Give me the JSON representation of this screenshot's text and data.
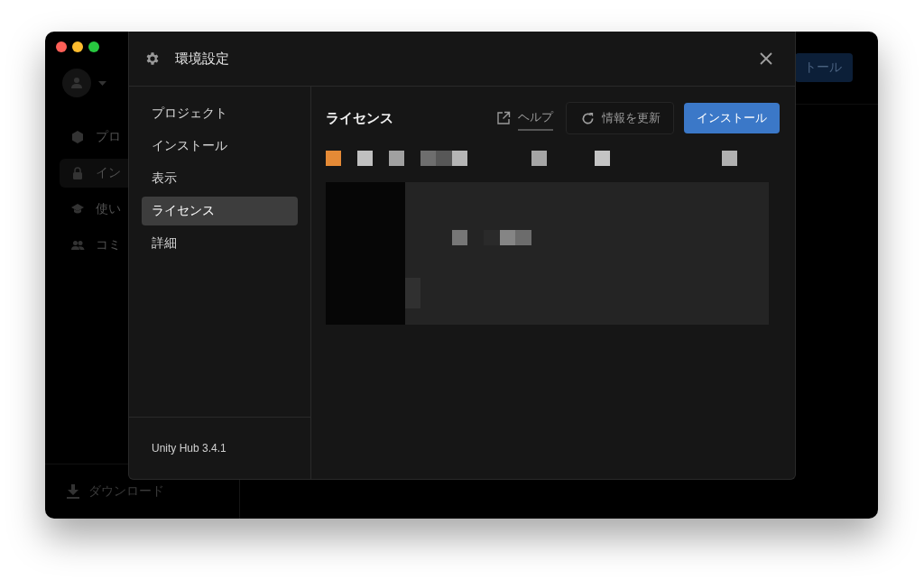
{
  "background_app": {
    "sidebar": {
      "items": [
        {
          "label": "プロ",
          "kind": "cube",
          "selected": false
        },
        {
          "label": "イン",
          "kind": "lock",
          "selected": true
        },
        {
          "label": "使い",
          "kind": "cap",
          "selected": false
        },
        {
          "label": "コミ",
          "kind": "people",
          "selected": false
        }
      ],
      "footer_item": "ダウンロード"
    },
    "header_button": "トール"
  },
  "dialog": {
    "title": "環境設定",
    "nav": [
      {
        "label": "プロジェクト",
        "selected": false
      },
      {
        "label": "インストール",
        "selected": false
      },
      {
        "label": "表示",
        "selected": false
      },
      {
        "label": "ライセンス",
        "selected": true
      },
      {
        "label": "詳細",
        "selected": false
      }
    ],
    "version": "Unity Hub 3.4.1",
    "content": {
      "title": "ライセンス",
      "help_link": "ヘルプ",
      "refresh_button": "情報を更新",
      "install_button": "インストール"
    }
  }
}
